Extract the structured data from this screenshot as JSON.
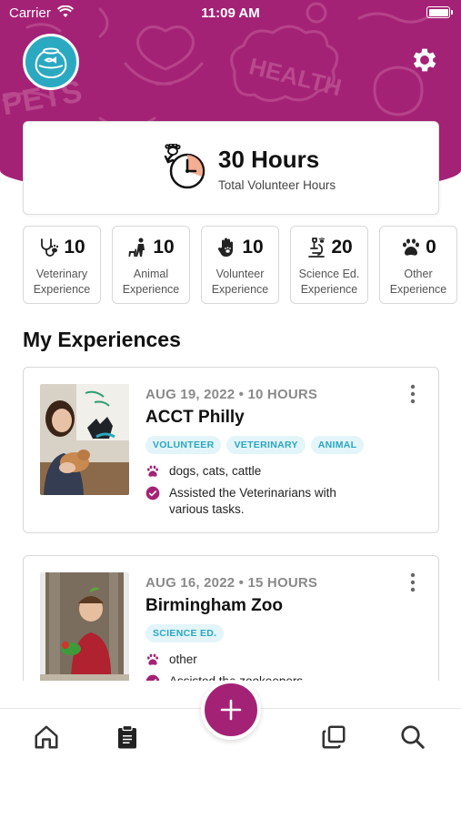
{
  "status_bar": {
    "carrier": "Carrier",
    "time": "11:09 AM"
  },
  "colors": {
    "brand": "#a42276",
    "accent": "#2ba9c1",
    "tag_bg": "#e3f5f9",
    "tag_text": "#2aa6c2"
  },
  "header": {
    "doodle_texts": [
      "HEALTH",
      "PETS"
    ]
  },
  "summary": {
    "hours": "30 Hours",
    "label": "Total Volunteer Hours"
  },
  "categories": [
    {
      "icon": "stethoscope-paw-icon",
      "count": "10",
      "label": "Veterinary Experience"
    },
    {
      "icon": "person-dog-icon",
      "count": "10",
      "label": "Animal Experience"
    },
    {
      "icon": "hand-paw-icon",
      "count": "10",
      "label": "Volunteer Experience"
    },
    {
      "icon": "microscope-icon",
      "count": "20",
      "label": "Science Ed. Experience"
    },
    {
      "icon": "paw-icon",
      "count": "0",
      "label": "Other Experience"
    }
  ],
  "section_title": "My Experiences",
  "experiences": [
    {
      "meta": "AUG 19, 2022 • 10 HOURS",
      "title": "ACCT Philly",
      "tags": [
        "VOLUNTEER",
        "VETERINARY",
        "ANIMAL"
      ],
      "animals": "dogs, cats, cattle",
      "description": "Assisted the Veterinarians with various tasks."
    },
    {
      "meta": "AUG 16, 2022 • 15 HOURS",
      "title": "Birmingham Zoo",
      "tags": [
        "SCIENCE ED."
      ],
      "animals": "other",
      "description": "Assisted the zookeepers"
    }
  ],
  "tabbar": {
    "items": [
      "home-icon",
      "clipboard-icon",
      "add-icon",
      "copy-icon",
      "search-icon"
    ]
  }
}
